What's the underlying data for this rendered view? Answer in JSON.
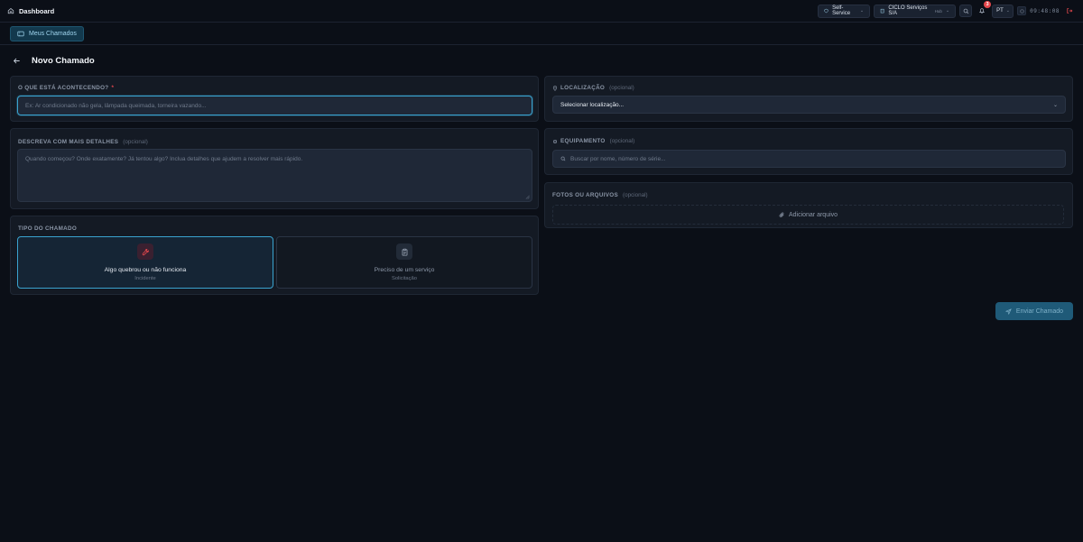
{
  "topbar": {
    "title": "Dashboard",
    "mode": "Self-Service",
    "company": "CICLO Serviços S/A",
    "company_tag": "Hub",
    "notifications": "3",
    "language": "PT",
    "time": "09:48:08"
  },
  "nav": {
    "tab": "Meus Chamados"
  },
  "page": {
    "title": "Novo Chamado"
  },
  "what": {
    "label": "O QUE ESTÁ ACONTECENDO?",
    "required": "*",
    "placeholder": "Ex: Ar condicionado não gela, lâmpada queimada, torneira vazando..."
  },
  "details": {
    "label": "DESCREVA COM MAIS DETALHES",
    "optional": "(opcional)",
    "placeholder": "Quando começou? Onde exatamente? Já tentou algo? Inclua detalhes que ajudem a resolver mais rápido."
  },
  "type": {
    "label": "TIPO DO CHAMADO",
    "options": [
      {
        "title": "Algo quebrou ou não funciona",
        "subtitle": "Incidente"
      },
      {
        "title": "Preciso de um serviço",
        "subtitle": "Solicitação"
      }
    ]
  },
  "location": {
    "label": "LOCALIZAÇÃO",
    "optional": "(opcional)",
    "value": "Selecionar localização..."
  },
  "equipment": {
    "label": "EQUIPAMENTO",
    "optional": "(opcional)",
    "placeholder": "Buscar por nome, número de série..."
  },
  "files": {
    "label": "FOTOS OU ARQUIVOS",
    "optional": "(opcional)",
    "add": "Adicionar arquivo"
  },
  "submit": {
    "label": "Enviar Chamado"
  },
  "colors": {
    "accent": "#3aa3cf",
    "background": "#0b0f17",
    "card": "#141a24",
    "danger": "#e5484d"
  }
}
